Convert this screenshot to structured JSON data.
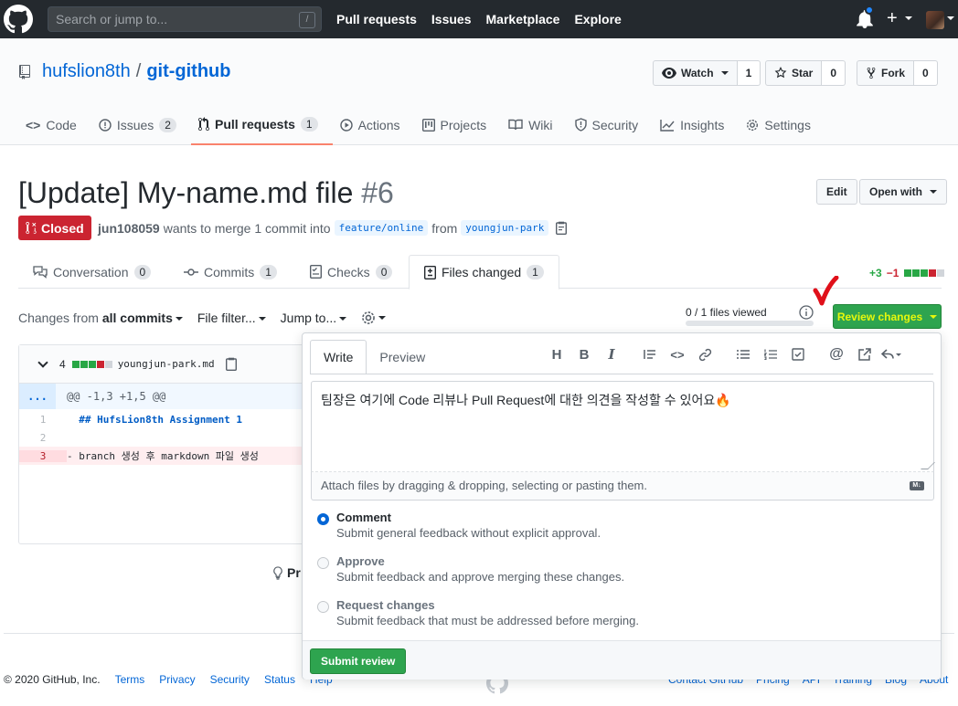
{
  "header": {
    "search_placeholder": "Search or jump to...",
    "search_shortcut": "/",
    "nav": [
      "Pull requests",
      "Issues",
      "Marketplace",
      "Explore"
    ]
  },
  "repo": {
    "owner": "hufslion8th",
    "separator": "/",
    "name": "git-github",
    "watch_label": "Watch",
    "watch_count": "1",
    "star_label": "Star",
    "star_count": "0",
    "fork_label": "Fork",
    "fork_count": "0",
    "tabs": [
      {
        "label": "Code",
        "count": ""
      },
      {
        "label": "Issues",
        "count": "2"
      },
      {
        "label": "Pull requests",
        "count": "1"
      },
      {
        "label": "Actions",
        "count": ""
      },
      {
        "label": "Projects",
        "count": ""
      },
      {
        "label": "Wiki",
        "count": ""
      },
      {
        "label": "Security",
        "count": ""
      },
      {
        "label": "Insights",
        "count": ""
      },
      {
        "label": "Settings",
        "count": ""
      }
    ]
  },
  "pr": {
    "title": "[Update] My-name.md file",
    "number": "#6",
    "edit_label": "Edit",
    "open_with_label": "Open with",
    "state": "Closed",
    "author": "jun108059",
    "merge_text": "wants to merge 1 commit into",
    "base_branch": "feature/online",
    "from_text": "from",
    "head_branch": "youngjun-park",
    "tabs": [
      {
        "label": "Conversation",
        "count": "0"
      },
      {
        "label": "Commits",
        "count": "1"
      },
      {
        "label": "Checks",
        "count": "0"
      },
      {
        "label": "Files changed",
        "count": "1"
      }
    ],
    "diffstat_add": "+3",
    "diffstat_del": "−1"
  },
  "toolbar": {
    "changes_prefix": "Changes from",
    "changes_value": "all commits",
    "file_filter": "File filter...",
    "jump_to": "Jump to...",
    "files_viewed": "0 / 1 files viewed",
    "files_viewed_fraction": 0,
    "review_changes": "Review changes"
  },
  "diff": {
    "count": "4",
    "filename": "youngjun-park.md",
    "hunk_dots": "...",
    "hunk_header": "@@ -1,3 +1,5 @@",
    "lines": [
      {
        "num": "1",
        "text": "  ## HufsLion8th Assignment 1",
        "type": "context"
      },
      {
        "num": "2",
        "text": "",
        "type": "context"
      },
      {
        "num": "3",
        "text": "- branch 생성 후 markdown 파일 생성",
        "type": "del"
      }
    ]
  },
  "review": {
    "write_tab": "Write",
    "preview_tab": "Preview",
    "tools": [
      "H",
      "B",
      "I"
    ],
    "body": "팀장은 여기에 Code 리뷰나 Pull Request에 대한 의견을 작성할 수 있어요🔥",
    "attach_hint": "Attach files by dragging & dropping, selecting or pasting them.",
    "md_badge": "M↓",
    "options": [
      {
        "title": "Comment",
        "desc": "Submit general feedback without explicit approval.",
        "selected": true
      },
      {
        "title": "Approve",
        "desc": "Submit feedback and approve merging these changes.",
        "selected": false
      },
      {
        "title": "Request changes",
        "desc": "Submit feedback that must be addressed before merging.",
        "selected": false
      }
    ],
    "submit_label": "Submit review"
  },
  "protip": "Pr",
  "footer": {
    "copyright": "© 2020 GitHub, Inc.",
    "links": [
      "Terms",
      "Privacy",
      "Security",
      "Status",
      "Help"
    ],
    "right_links": [
      "Contact GitHub",
      "Pricing",
      "API",
      "Training",
      "Blog",
      "About"
    ]
  },
  "colors": {
    "header_bg": "#24292e",
    "link": "#0366d6",
    "closed_red": "#cb2431",
    "green": "#2ea44f",
    "review_text_highlight": "#e6f70d",
    "annotation_check": "#e0101a"
  }
}
